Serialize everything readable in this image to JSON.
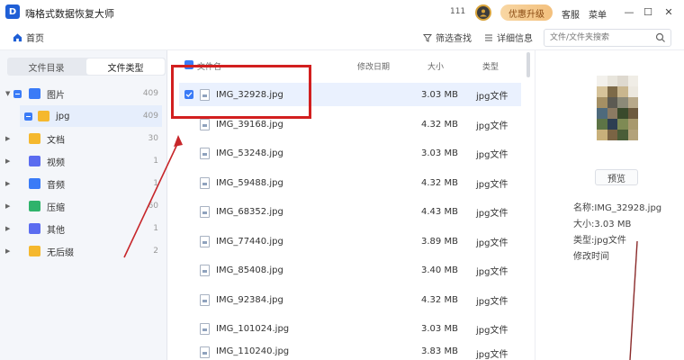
{
  "titlebar": {
    "logo_letter": "D",
    "app_title": "嗨格式数据恢复大师",
    "counter": "111",
    "upgrade_label": "优惠升级",
    "service_label": "客服",
    "menu_label": "菜单",
    "minimize_glyph": "—",
    "maximize_glyph": "☐",
    "close_glyph": "✕",
    "upgrade_color": "#f3c07d"
  },
  "toolbar": {
    "home_label": "首页",
    "filter_label": "筛选查找",
    "detail_label": "详细信息",
    "search_placeholder": "文件/文件夹搜索"
  },
  "sidebar": {
    "tabs": [
      {
        "label": "文件目录",
        "active": false
      },
      {
        "label": "文件类型",
        "active": true
      }
    ],
    "items": [
      {
        "label": "图片",
        "count": "409",
        "icon": "image-folder-icon",
        "color": "#3a7bf7",
        "expanded": true
      },
      {
        "label": "jpg",
        "count": "409",
        "icon": "folder-icon",
        "color": "#f5b82e",
        "selected": true
      },
      {
        "label": "文档",
        "count": "30",
        "icon": "document-folder-icon",
        "color": "#f5b82e"
      },
      {
        "label": "视频",
        "count": "1",
        "icon": "video-folder-icon",
        "color": "#5b6cf0"
      },
      {
        "label": "音频",
        "count": "1",
        "icon": "audio-folder-icon",
        "color": "#3a7bf7"
      },
      {
        "label": "压缩",
        "count": "60",
        "icon": "archive-folder-icon",
        "color": "#2fb36b"
      },
      {
        "label": "其他",
        "count": "1",
        "icon": "other-folder-icon",
        "color": "#5b6cf0"
      },
      {
        "label": "无后缀",
        "count": "2",
        "icon": "no-extension-folder-icon",
        "color": "#f5b82e"
      }
    ]
  },
  "filelist": {
    "headers": {
      "name": "文件名",
      "date": "修改日期",
      "size": "大小",
      "type": "类型"
    },
    "rows": [
      {
        "name": "IMG_32928.jpg",
        "size": "3.03 MB",
        "type": "jpg文件",
        "selected": true
      },
      {
        "name": "IMG_39168.jpg",
        "size": "4.32 MB",
        "type": "jpg文件"
      },
      {
        "name": "IMG_53248.jpg",
        "size": "3.03 MB",
        "type": "jpg文件"
      },
      {
        "name": "IMG_59488.jpg",
        "size": "4.32 MB",
        "type": "jpg文件"
      },
      {
        "name": "IMG_68352.jpg",
        "size": "4.43 MB",
        "type": "jpg文件"
      },
      {
        "name": "IMG_77440.jpg",
        "size": "3.89 MB",
        "type": "jpg文件"
      },
      {
        "name": "IMG_85408.jpg",
        "size": "3.40 MB",
        "type": "jpg文件"
      },
      {
        "name": "IMG_92384.jpg",
        "size": "4.32 MB",
        "type": "jpg文件"
      },
      {
        "name": "IMG_101024.jpg",
        "size": "3.03 MB",
        "type": "jpg文件"
      },
      {
        "name": "IMG_110240.jpg",
        "size": "3.83 MB",
        "type": "jpg文件"
      }
    ]
  },
  "preview": {
    "preview_button": "预览",
    "name_line": "名称:IMG_32928.jpg",
    "size_line": "大小:3.03 MB",
    "type_line": "类型:jpg文件",
    "date_line": "修改时间",
    "collapse_glyph": "›"
  },
  "annotation_color": "#d21f1f"
}
